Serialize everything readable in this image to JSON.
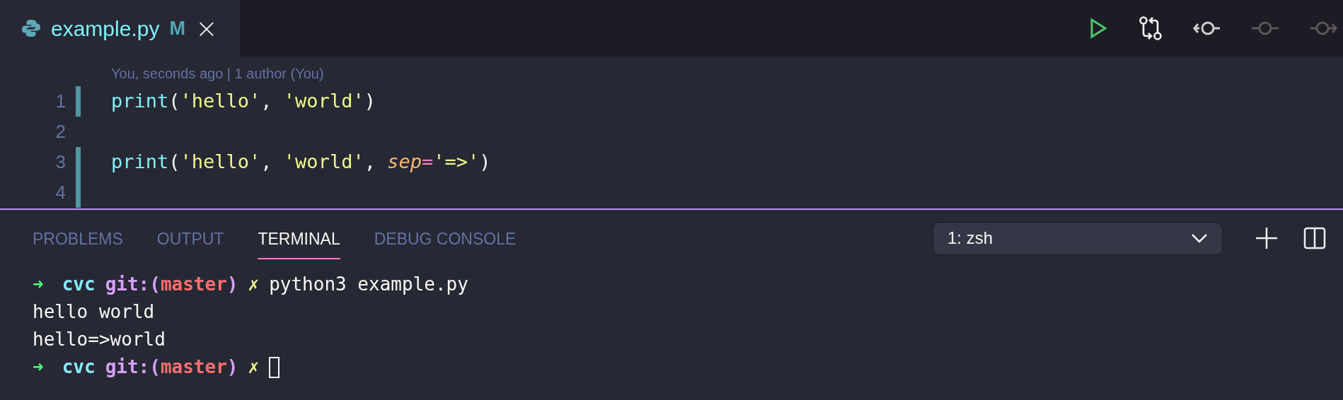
{
  "editor_tab": {
    "filename": "example.py",
    "git_status": "M",
    "close": "×"
  },
  "toolbar": [
    {
      "kind": "run",
      "disabled": false
    },
    {
      "kind": "compare",
      "disabled": false
    },
    {
      "kind": "previous",
      "disabled": false
    },
    {
      "kind": "commit",
      "disabled": true
    },
    {
      "kind": "next",
      "disabled": true
    }
  ],
  "blame": "You, seconds ago | 1 author (You)",
  "code_lines": [
    {
      "number": "1",
      "modified": true,
      "tokens": [
        {
          "kind": "function",
          "text": "print"
        },
        {
          "kind": "punct",
          "text": "("
        },
        {
          "kind": "string",
          "text": "'hello'"
        },
        {
          "kind": "punct",
          "text": ", "
        },
        {
          "kind": "string",
          "text": "'world'"
        },
        {
          "kind": "punct",
          "text": ")"
        }
      ]
    },
    {
      "number": "2",
      "modified": false
    },
    {
      "number": "3",
      "modified": true,
      "tokens": [
        {
          "kind": "function",
          "text": "print"
        },
        {
          "kind": "punct",
          "text": "("
        },
        {
          "kind": "string",
          "text": "'hello'"
        },
        {
          "kind": "punct",
          "text": ", "
        },
        {
          "kind": "string",
          "text": "'world'"
        },
        {
          "kind": "punct",
          "text": ", "
        },
        {
          "kind": "param",
          "text": "sep"
        },
        {
          "kind": "operator",
          "text": "="
        },
        {
          "kind": "string",
          "text": "'=>'"
        },
        {
          "kind": "punct",
          "text": ")"
        }
      ]
    },
    {
      "number": "4",
      "modified": true
    }
  ],
  "panel_tabs": [
    {
      "label": "PROBLEMS",
      "selected": false
    },
    {
      "label": "OUTPUT",
      "selected": false
    },
    {
      "label": "TERMINAL",
      "selected": true
    },
    {
      "label": "DEBUG CONSOLE",
      "selected": false
    }
  ],
  "terminal_select": {
    "value": "1: zsh"
  },
  "terminal_lines": [
    {
      "tokens": [
        {
          "kind": "arrow",
          "text": "➜"
        },
        {
          "kind": "dir",
          "text": "cvc"
        },
        {
          "kind": "git",
          "text": "git:("
        },
        {
          "kind": "branch",
          "text": "master"
        },
        {
          "kind": "git",
          "text": ")"
        },
        {
          "kind": "dirty",
          "text": "✗"
        },
        {
          "kind": "command",
          "text": "python3 example.py"
        }
      ]
    },
    {
      "tokens": [
        {
          "kind": "output",
          "text": "hello world"
        }
      ]
    },
    {
      "tokens": [
        {
          "kind": "output",
          "text": "hello=>world"
        }
      ]
    },
    {
      "tokens": [
        {
          "kind": "arrow",
          "text": "➜"
        },
        {
          "kind": "dir",
          "text": "cvc"
        },
        {
          "kind": "git",
          "text": "git:("
        },
        {
          "kind": "branch",
          "text": "master"
        },
        {
          "kind": "git",
          "text": ")"
        },
        {
          "kind": "dirty",
          "text": "✗"
        }
      ],
      "cursor": true
    }
  ]
}
